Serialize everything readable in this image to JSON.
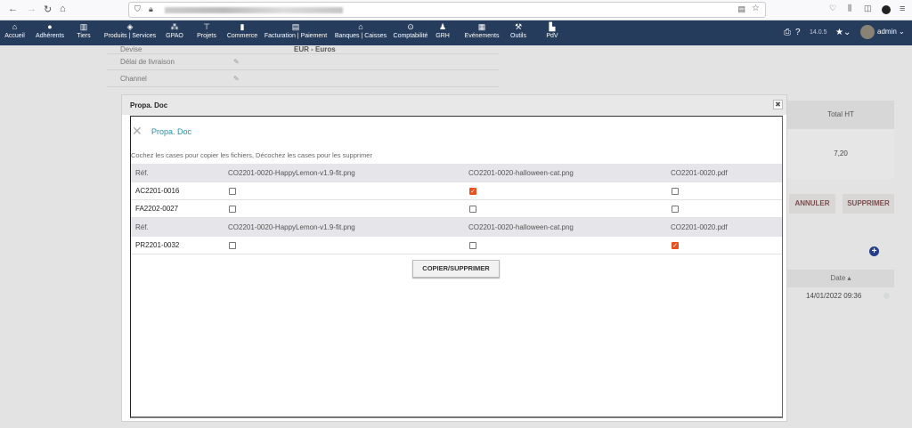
{
  "browser": {
    "back": "←",
    "forward": "→",
    "reload": "↻",
    "home": "⌂"
  },
  "nav": {
    "items": [
      {
        "label": "Accueil",
        "icon": "home-icon",
        "glyph": "⌂"
      },
      {
        "label": "Adhérents",
        "icon": "user-icon",
        "glyph": "●"
      },
      {
        "label": "Tiers",
        "icon": "building-icon",
        "glyph": "▥"
      },
      {
        "label": "Produits | Services",
        "icon": "cube-icon",
        "glyph": "◈"
      },
      {
        "label": "GPAO",
        "icon": "cubes-icon",
        "glyph": "⁂"
      },
      {
        "label": "Projets",
        "icon": "sitemap-icon",
        "glyph": "⊤"
      },
      {
        "label": "Commerce",
        "icon": "briefcase-icon",
        "glyph": "▮"
      },
      {
        "label": "Facturation | Paiement",
        "icon": "money-icon",
        "glyph": "▤"
      },
      {
        "label": "Banques | Caisses",
        "icon": "bank-icon",
        "glyph": "⌂"
      },
      {
        "label": "Comptabilité",
        "icon": "search-dollar-icon",
        "glyph": "⊙"
      },
      {
        "label": "GRH",
        "icon": "user-tie-icon",
        "glyph": "♟"
      },
      {
        "label": "Evénements",
        "icon": "calendar-icon",
        "glyph": "▦"
      },
      {
        "label": "Outils",
        "icon": "wrench-icon",
        "glyph": "⚒"
      },
      {
        "label": "PdV",
        "icon": "cash-register-icon",
        "glyph": "▙"
      }
    ],
    "version": "14.0.5",
    "user": "admin"
  },
  "background": {
    "fields": [
      {
        "label": "Devise",
        "value": "EUR - Euros"
      },
      {
        "label": "Délai de livraison"
      },
      {
        "label": "Channel"
      }
    ],
    "total_header": "Total HT",
    "total_value": "7,20",
    "cancel": "ANNULER",
    "delete": "SUPPRIMER",
    "date_header": "Date ▴",
    "date_value": "14/01/2022 09:36"
  },
  "modal": {
    "title": "Propa. Doc",
    "close": "✖",
    "heading": "Propa. Doc",
    "instructions": "Cochez les cases pour copier les fichiers, Décochez les cases pour les supprimer",
    "ref_label": "Réf.",
    "files": [
      "CO2201-0020-HappyLemon-v1.9-fit.png",
      "CO2201-0020-halloween-cat.png",
      "CO2201-0020.pdf"
    ],
    "groups": [
      {
        "rows": [
          {
            "ref": "AC2201-0016",
            "checked": [
              false,
              true,
              false
            ]
          },
          {
            "ref": "FA2202-0027",
            "checked": [
              false,
              false,
              false
            ]
          }
        ]
      },
      {
        "rows": [
          {
            "ref": "PR2201-0032",
            "checked": [
              false,
              false,
              true
            ]
          }
        ]
      }
    ],
    "button": "COPIER/SUPPRIMER"
  }
}
